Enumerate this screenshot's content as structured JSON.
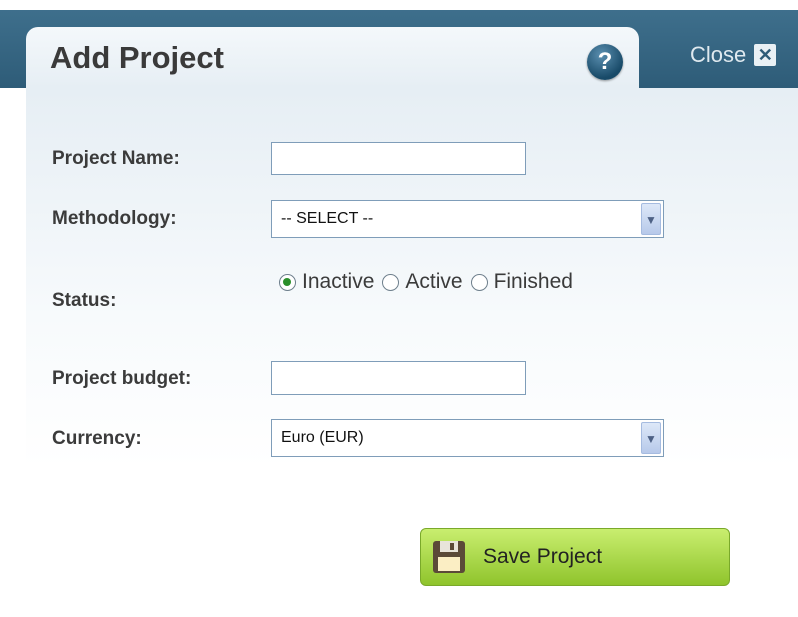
{
  "dialog": {
    "title": "Add Project",
    "help_icon": "?",
    "close_label": "Close",
    "close_icon": "✕"
  },
  "form": {
    "project_name_label": "Project Name:",
    "project_name_value": "",
    "methodology_label": "Methodology:",
    "methodology_selected": "-- SELECT --",
    "status_label": "Status:",
    "status_options": [
      "Inactive",
      "Active",
      "Finished"
    ],
    "status_selected": "Inactive",
    "budget_label": "Project budget:",
    "budget_value": "",
    "currency_label": "Currency:",
    "currency_selected": "Euro (EUR)"
  },
  "actions": {
    "save_label": "Save Project",
    "save_icon": "floppy-disk-icon"
  },
  "colors": {
    "header": "#2e5c78",
    "save_button": "#a6d43c"
  }
}
